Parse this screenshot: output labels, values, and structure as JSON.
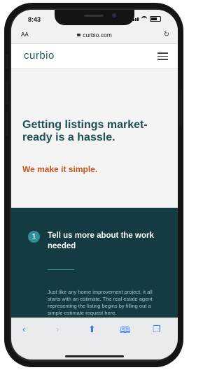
{
  "status": {
    "time": "8:43"
  },
  "browser": {
    "aa": "AA",
    "url": "curbio.com"
  },
  "site": {
    "logo": "curbio"
  },
  "hero": {
    "headline": "Getting listings market-ready is a hassle.",
    "tagline": "We make it simple."
  },
  "step": {
    "number": "1",
    "title": "Tell us more about the work needed",
    "body": "Just like any home improvement project, it all starts with an estimate. The real estate agent representing the listing begins by filling out a simple estimate request here."
  },
  "colors": {
    "brand_teal": "#1f5c63",
    "accent_orange": "#c8541f",
    "dark_section": "#143b41"
  },
  "icons": [
    "lock-icon",
    "reload-icon",
    "menu-icon",
    "back-icon",
    "forward-icon",
    "share-icon",
    "bookmarks-icon",
    "tabs-icon"
  ]
}
